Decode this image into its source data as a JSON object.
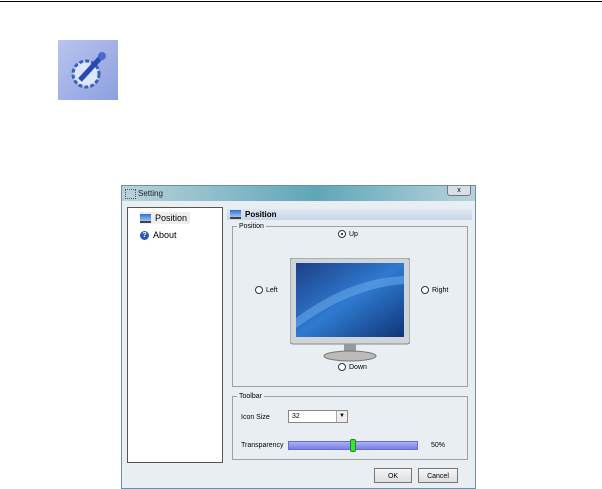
{
  "dialog": {
    "title": "Setting",
    "close": "x"
  },
  "sidebar": {
    "items": [
      {
        "label": "Position",
        "icon": "monitor-icon"
      },
      {
        "label": "About",
        "icon": "help-icon"
      }
    ]
  },
  "panel": {
    "header": "Position",
    "position_group": {
      "legend": "Position",
      "options": {
        "up": "Up",
        "left": "Left",
        "right": "Right",
        "down": "Down"
      },
      "selected": "Up"
    },
    "toolbar_group": {
      "legend": "Toolbar",
      "icon_size_label": "Icon Size",
      "icon_size_value": "32",
      "transparency_label": "Transparency",
      "transparency_value": "50%",
      "transparency_fraction": 0.5
    }
  },
  "buttons": {
    "ok": "OK",
    "cancel": "Cancel"
  }
}
